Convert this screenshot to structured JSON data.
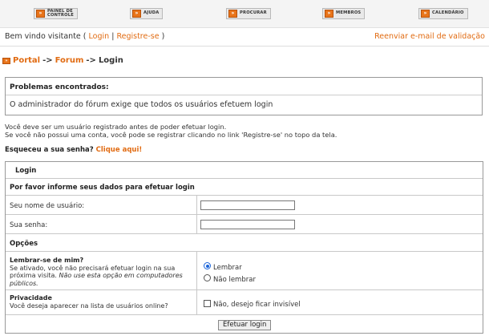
{
  "nav": {
    "buttons": [
      {
        "line1": "PAINEL DE",
        "line2": "CONTROLE"
      },
      {
        "line1": "AJUDA",
        "line2": ""
      },
      {
        "line1": "PROCURAR",
        "line2": ""
      },
      {
        "line1": "MEMBROS",
        "line2": ""
      },
      {
        "line1": "CALENDÁRIO",
        "line2": ""
      }
    ]
  },
  "welcome": {
    "prefix": "Bem vindo visitante (",
    "login": "Login",
    "sep": "|",
    "register": "Registre-se",
    "suffix": ")",
    "resend": "Reenviar e-mail de validação"
  },
  "breadcrumb": {
    "portal": "Portal",
    "arrow1": "->",
    "forum": "Forum",
    "arrow2": "->",
    "current": "Login"
  },
  "problems": {
    "title": "Problemas encontrados:",
    "message": "O administrador do fórum exige que todos os usuários efetuem login"
  },
  "info": {
    "line1": "Você deve ser um usuário registrado antes de poder efetuar login.",
    "line2": "Se você não possui uma conta, você pode se registrar clicando no link 'Registre-se' no topo da tela."
  },
  "forgot": {
    "text": "Esqueceu a sua senha?",
    "link": "Clique aqui!"
  },
  "login_form": {
    "header": "Login",
    "subheader": "Por favor informe seus dados para efetuar login",
    "username_label": "Seu nome de usuário:",
    "username_value": "",
    "password_label": "Sua senha:",
    "password_value": "",
    "options_header": "Opções",
    "remember_title": "Lembrar-se de mim?",
    "remember_desc1": "Se ativado, você não precisará efetuar login na sua",
    "remember_desc2": "próxima visita.",
    "remember_warn1": "Não use esta opção em computadores",
    "remember_warn2": "públicos.",
    "remember_yes": "Lembrar",
    "remember_no": "Não lembrar",
    "privacy_title": "Privacidade",
    "privacy_desc": "Você deseja aparecer na lista de usuários online?",
    "privacy_option": "Não, desejo ficar invisível",
    "submit": "Efetuar login"
  },
  "colors": {
    "accent": "#e16b12"
  }
}
